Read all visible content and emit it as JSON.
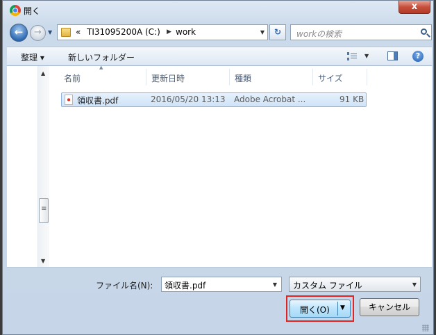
{
  "window": {
    "title": "開く",
    "close_label": "x"
  },
  "nav": {
    "back_glyph": "←",
    "forward_glyph": "→",
    "address": {
      "chevrons": "«",
      "drive": "TI31095200A (C:)",
      "folder": "work"
    },
    "search_placeholder": "workの検索"
  },
  "toolbar": {
    "organize_label": "整理 ▾",
    "new_folder_label": "新しいフォルダー",
    "help_glyph": "?"
  },
  "columns": {
    "name": "名前",
    "modified": "更新日時",
    "type": "種類",
    "size": "サイズ"
  },
  "files": [
    {
      "name": "領収書.pdf",
      "modified": "2016/05/20 13:13",
      "type": "Adobe Acrobat ...",
      "size": "91 KB",
      "selected": true
    }
  ],
  "footer": {
    "filename_label": "ファイル名(N):",
    "filename_value": "領収書.pdf",
    "filetype_value": "カスタム ファイル",
    "open_label": "開く(O)",
    "cancel_label": "キャンセル"
  },
  "colors": {
    "highlight_border": "#e02424",
    "selection": "#cfe3f8"
  }
}
